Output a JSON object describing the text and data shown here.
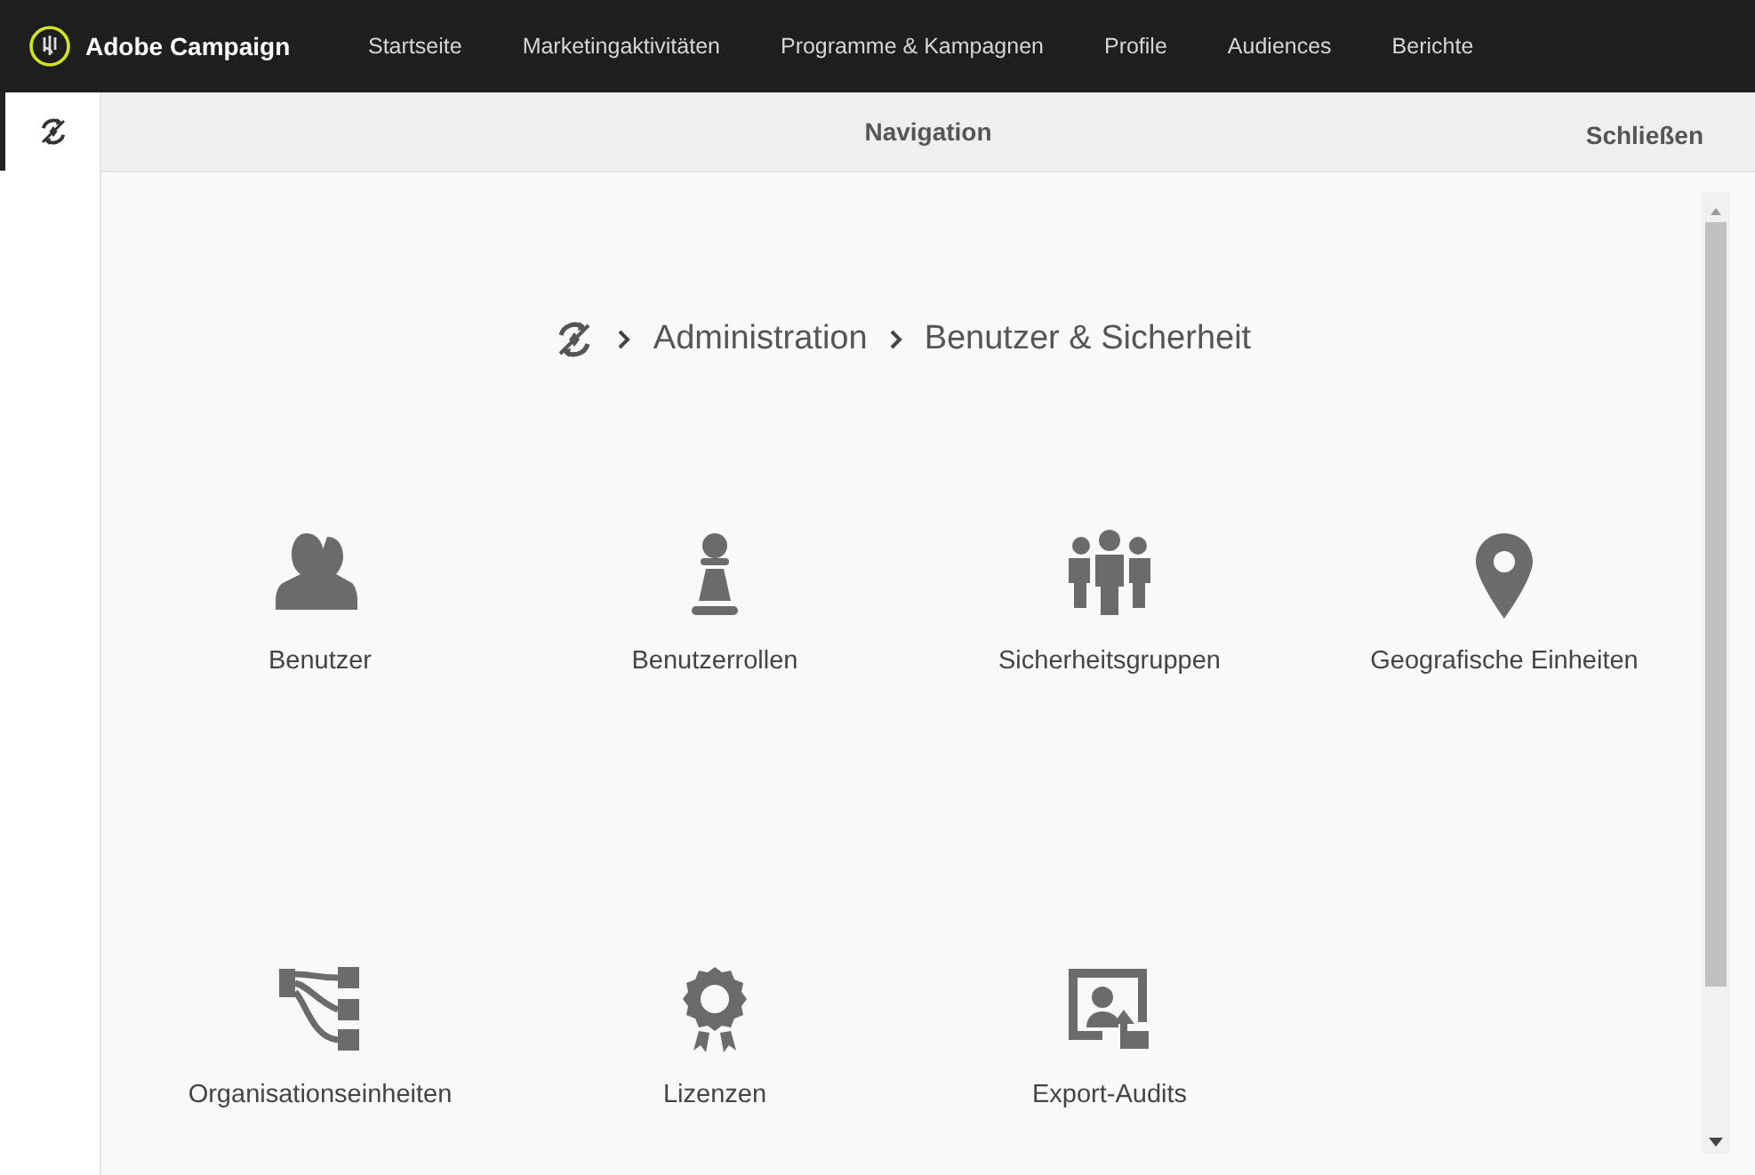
{
  "app": {
    "title": "Adobe Campaign"
  },
  "nav": [
    "Startseite",
    "Marketingaktivitäten",
    "Programme & Kampagnen",
    "Profile",
    "Audiences",
    "Berichte"
  ],
  "sidebar": {
    "items": [
      {
        "selected": true
      }
    ]
  },
  "panel": {
    "title": "Navigation",
    "close": "Schließen"
  },
  "breadcrumb": [
    "Administration",
    "Benutzer & Sicherheit"
  ],
  "tiles": [
    {
      "kind": "users",
      "label": "Benutzer"
    },
    {
      "kind": "roles",
      "label": "Benutzerrollen"
    },
    {
      "kind": "groups",
      "label": "Sicherheitsgruppen"
    },
    {
      "kind": "geo",
      "label": "Geografische Einheiten"
    },
    {
      "kind": "org",
      "label": "Organisationseinheiten"
    },
    {
      "kind": "license",
      "label": "Lizenzen"
    },
    {
      "kind": "audit",
      "label": "Export-Audits"
    }
  ]
}
